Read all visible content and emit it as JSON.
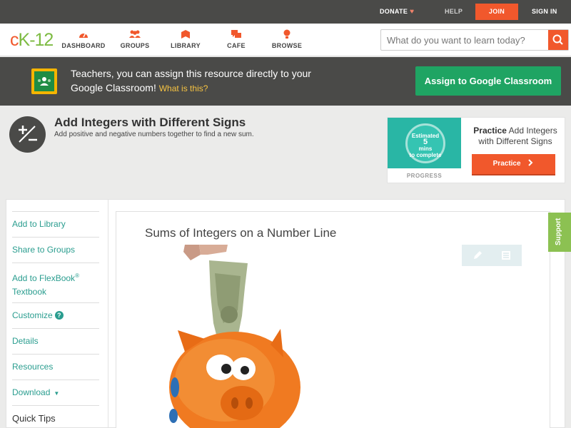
{
  "topbar": {
    "donate": "DONATE",
    "help": "HELP",
    "join": "JOIN",
    "signin": "SIGN IN"
  },
  "nav": {
    "logo_c": "c",
    "logo_k": "K",
    "logo_dash": "-",
    "logo_num": "12",
    "items": [
      {
        "label": "DASHBOARD",
        "icon": "dashboard-icon"
      },
      {
        "label": "GROUPS",
        "icon": "groups-icon"
      },
      {
        "label": "LIBRARY",
        "icon": "library-icon"
      },
      {
        "label": "CAFE",
        "icon": "cafe-icon"
      },
      {
        "label": "BROWSE",
        "icon": "browse-icon"
      }
    ],
    "search_placeholder": "What do you want to learn today?"
  },
  "classroom": {
    "text": "Teachers, you can assign this resource directly to your Google Classroom!",
    "what_is": "What is this?",
    "button": "Assign to Google Classroom"
  },
  "header": {
    "title": "Add Integers with Different Signs",
    "subtitle": "Add positive and negative numbers together to find a new sum."
  },
  "practice_card": {
    "estimated": "Estimated",
    "minutes": "5",
    "mins_label": "mins",
    "to_complete": "to complete",
    "progress": "PROGRESS",
    "title_bold": "Practice",
    "title_rest": "Add Integers with Different Signs",
    "button": "Practice"
  },
  "sidebar": {
    "add_library": "Add to Library",
    "share_groups": "Share to Groups",
    "add_flexbook": "Add to FlexBook",
    "reg": "®",
    "textbook": "Textbook",
    "customize": "Customize",
    "details": "Details",
    "resources": "Resources",
    "download": "Download",
    "quick_tips": "Quick Tips"
  },
  "article": {
    "title": "Sums of Integers on a Number Line"
  },
  "support": "Support",
  "colors": {
    "accent": "#f1582c",
    "brand_green": "#7dbb42",
    "classroom_green": "#1fa463",
    "teal": "#2a9d8f",
    "dark_bar": "#4a4a48"
  }
}
